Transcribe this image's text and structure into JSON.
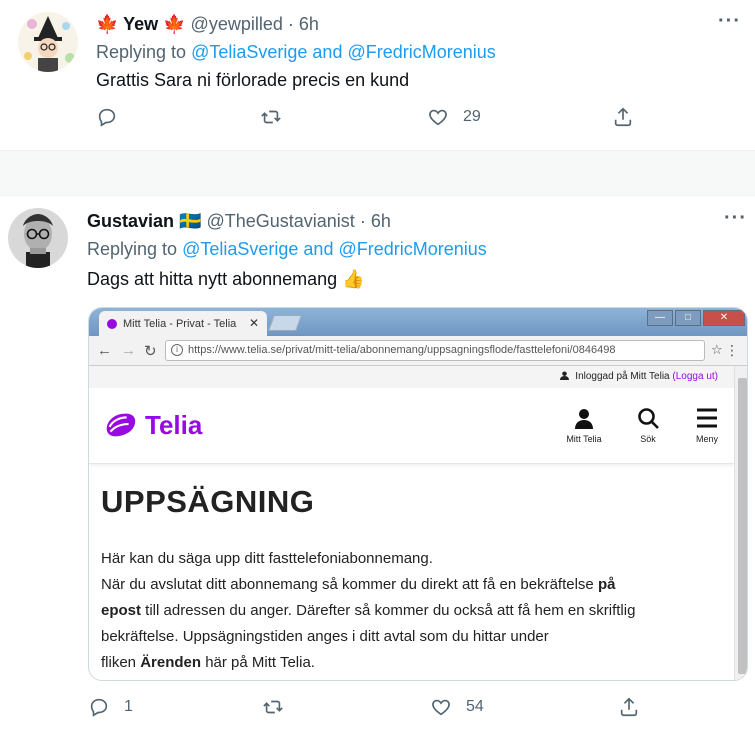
{
  "tweets": [
    {
      "name": "🍁 Yew 🍁",
      "handle": "@yewpilled",
      "time": "· 6h",
      "replying_prefix": "Replying to",
      "mention1": "@TeliaSverige",
      "and": "and",
      "mention2": "@FredricMorenius",
      "text": "Grattis Sara ni förlorade precis en kund",
      "more": "···",
      "reply_count": "",
      "retweet_count": "",
      "like_count": "29"
    },
    {
      "name": "Gustavian 🇸🇪",
      "handle": "@TheGustavianist",
      "time": "· 6h",
      "replying_prefix": "Replying to",
      "mention1": "@TeliaSverige",
      "and": "and",
      "mention2": "@FredricMorenius",
      "text": "Dags att hitta nytt abonnemang 👍",
      "more": "···",
      "reply_count": "1",
      "retweet_count": "",
      "like_count": "54"
    }
  ],
  "screenshot": {
    "tab_title": "Mitt Telia - Privat - Telia",
    "tab_close": "✕",
    "url": "https://www.telia.se/privat/mitt-telia/abonnemang/uppsagningsflode/fasttelefoni/0846498",
    "logged_in_text": "Inloggad på Mitt Telia",
    "logout_text": "(Logga ut)",
    "logo_text": "Telia",
    "header_icons": [
      {
        "label": "Mitt Telia"
      },
      {
        "label": "Sök"
      },
      {
        "label": "Meny"
      }
    ],
    "heading": "UPPSÄGNING",
    "line1": "Här kan du säga upp ditt fasttelefoniabonnemang.",
    "line2a": "När du avslutat ditt abonnemang så kommer du direkt att få en bekräftelse ",
    "line2b": "på",
    "line3a": "epost",
    "line3b": " till adressen du anger. Därefter så kommer du också att få hem en skriftlig",
    "line4": "bekräftelse. Uppsägningstiden anges i ditt avtal som du hittar under",
    "line5a": "fliken ",
    "line5b": "Ärenden",
    "line5c": " här på Mitt Telia.",
    "brand_color": "#990ae3"
  },
  "colors": {
    "link": "#1d9bf0",
    "secondary": "#536471"
  }
}
